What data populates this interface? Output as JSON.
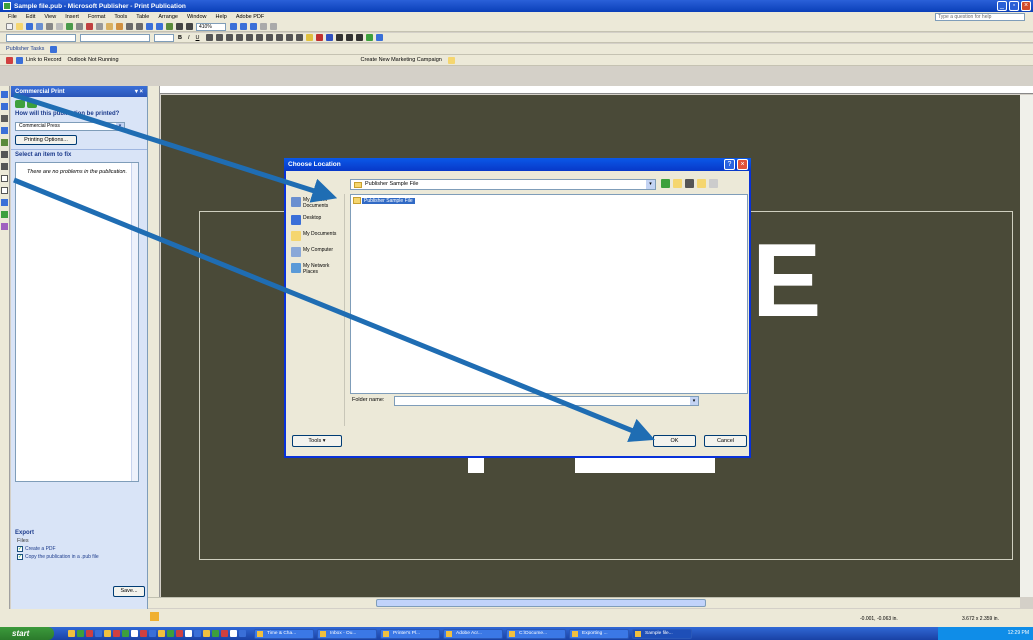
{
  "window": {
    "title": "Sample file.pub - Microsoft Publisher - Print Publication"
  },
  "menu": [
    "File",
    "Edit",
    "View",
    "Insert",
    "Format",
    "Tools",
    "Table",
    "Arrange",
    "Window",
    "Help",
    "Adobe PDF"
  ],
  "help_placeholder": "Type a question for help",
  "toolbar": {
    "zoom": "410%",
    "publisher_tasks": "Publisher Tasks",
    "link_to_record": "Link to Record",
    "outlook_status": "Outlook Not Running",
    "campaign": "Create New Marketing Campaign"
  },
  "taskpane": {
    "title": "Commercial Print",
    "question": "How will this publication be printed?",
    "print_method": "Commercial Press",
    "printing_options": "Printing Options...",
    "select_item": "Select an item to fix",
    "no_problems": "There are no problems in the publication.",
    "export_header": "Export",
    "files_label": "Files",
    "create_pdf": "Create a PDF",
    "copy_pub": "Copy the publication in a .pub file",
    "save_button": "Save..."
  },
  "canvas_text": {
    "big_letter": "E"
  },
  "dialog": {
    "title": "Choose Location",
    "look_in": "Publisher Sample File",
    "places": [
      "My Recent Documents",
      "Desktop",
      "My Documents",
      "My Computer",
      "My Network Places"
    ],
    "selected_item": "Publisher Sample File",
    "folder_name_label": "Folder name:",
    "tools_button": "Tools",
    "ok_button": "OK",
    "cancel_button": "Cancel"
  },
  "status": {
    "position": "-0.001, -0.063 in.",
    "size": "3.672 x 2.359 in."
  },
  "taskbar": {
    "start": "start",
    "tasks": [
      "Time & Cha...",
      "Inbox - Ou...",
      "Printer's Pl...",
      "Adobe Acr...",
      "C:\\Docume...",
      "Exporting ...",
      "Sample file..."
    ],
    "clock": "12:29 PM"
  },
  "colors": {
    "title_blue": "#0a3fb8",
    "canvas": "#4a4a38",
    "arrow": "#1f6db3"
  }
}
